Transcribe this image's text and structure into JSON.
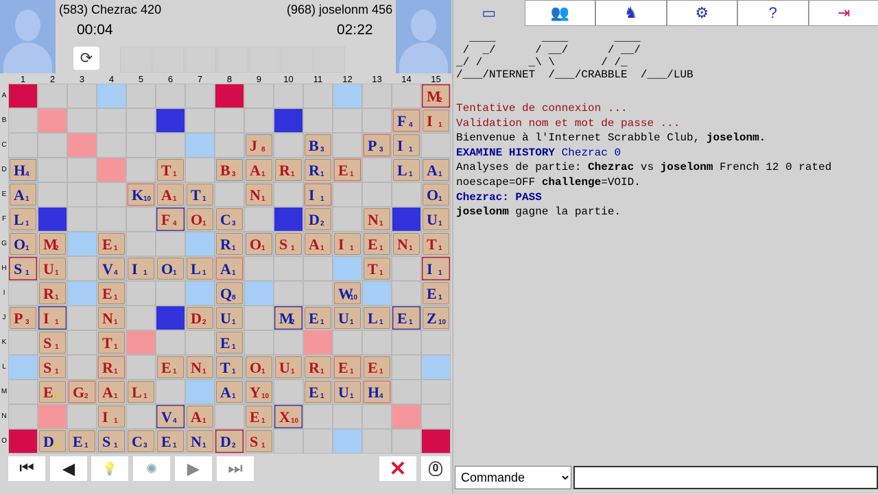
{
  "players": {
    "left": {
      "rating_name": "(583) Chezrac 420",
      "time": "00:04"
    },
    "right": {
      "rating_name": "(968) joselonm 456",
      "time": "02:22"
    }
  },
  "board": {
    "columns": [
      "1",
      "2",
      "3",
      "4",
      "5",
      "6",
      "7",
      "8",
      "9",
      "10",
      "11",
      "12",
      "13",
      "14",
      "15"
    ],
    "rows": [
      "A",
      "B",
      "C",
      "D",
      "E",
      "F",
      "G",
      "H",
      "I",
      "J",
      "K",
      "L",
      "M",
      "N",
      "O"
    ],
    "premium": [
      "T..d...T...d..T",
      ".D...t...t...D.",
      "..D...d.d...D..",
      "d..D...d...D..d",
      "....D.....D....",
      ".t...t...t...t.",
      "..d...d.d...d..",
      "T..d...D...d..T",
      "..d...d.d...d..",
      ".t...t...t...t.",
      "....D.....D....",
      "d..D...d...D..d",
      "..D...d.d...D..",
      ".D...t...t...D.",
      "T..d...T...d..T"
    ],
    "tiles": [
      {
        "r": 0,
        "c": 14,
        "l": "M",
        "p": "2",
        "col": "red"
      },
      {
        "r": 1,
        "c": 13,
        "l": "F",
        "p": "4",
        "col": "blue"
      },
      {
        "r": 1,
        "c": 14,
        "l": "I",
        "p": "1",
        "col": "red"
      },
      {
        "r": 2,
        "c": 8,
        "l": "J",
        "p": "8",
        "col": "red"
      },
      {
        "r": 2,
        "c": 10,
        "l": "B",
        "p": "3",
        "col": "blue"
      },
      {
        "r": 2,
        "c": 12,
        "l": "P",
        "p": "3",
        "col": "blue"
      },
      {
        "r": 2,
        "c": 13,
        "l": "I",
        "p": "1",
        "col": "blue"
      },
      {
        "r": 3,
        "c": 0,
        "l": "H",
        "p": "4",
        "col": "blue"
      },
      {
        "r": 3,
        "c": 5,
        "l": "T",
        "p": "1",
        "col": "red"
      },
      {
        "r": 3,
        "c": 7,
        "l": "B",
        "p": "3",
        "col": "red"
      },
      {
        "r": 3,
        "c": 8,
        "l": "A",
        "p": "1",
        "col": "red"
      },
      {
        "r": 3,
        "c": 9,
        "l": "R",
        "p": "1",
        "col": "red"
      },
      {
        "r": 3,
        "c": 10,
        "l": "R",
        "p": "1",
        "col": "blue"
      },
      {
        "r": 3,
        "c": 11,
        "l": "E",
        "p": "1",
        "col": "red"
      },
      {
        "r": 3,
        "c": 13,
        "l": "L",
        "p": "1",
        "col": "blue"
      },
      {
        "r": 3,
        "c": 14,
        "l": "A",
        "p": "1",
        "col": "blue"
      },
      {
        "r": 4,
        "c": 0,
        "l": "A",
        "p": "1",
        "col": "blue"
      },
      {
        "r": 4,
        "c": 4,
        "l": "K",
        "p": "10",
        "col": "blue"
      },
      {
        "r": 4,
        "c": 5,
        "l": "A",
        "p": "1",
        "col": "red"
      },
      {
        "r": 4,
        "c": 6,
        "l": "T",
        "p": "1",
        "col": "blue"
      },
      {
        "r": 4,
        "c": 8,
        "l": "N",
        "p": "1",
        "col": "red"
      },
      {
        "r": 4,
        "c": 10,
        "l": "I",
        "p": "1",
        "col": "blue"
      },
      {
        "r": 4,
        "c": 14,
        "l": "O",
        "p": "1",
        "col": "blue"
      },
      {
        "r": 5,
        "c": 0,
        "l": "L",
        "p": "1",
        "col": "blue"
      },
      {
        "r": 5,
        "c": 5,
        "l": "F",
        "p": "4",
        "col": "red"
      },
      {
        "r": 5,
        "c": 6,
        "l": "O",
        "p": "1",
        "col": "red"
      },
      {
        "r": 5,
        "c": 7,
        "l": "C",
        "p": "3",
        "col": "blue"
      },
      {
        "r": 5,
        "c": 10,
        "l": "D",
        "p": "2",
        "col": "blue"
      },
      {
        "r": 5,
        "c": 12,
        "l": "N",
        "p": "1",
        "col": "red"
      },
      {
        "r": 5,
        "c": 14,
        "l": "U",
        "p": "1",
        "col": "blue"
      },
      {
        "r": 6,
        "c": 0,
        "l": "O",
        "p": "1",
        "col": "blue"
      },
      {
        "r": 6,
        "c": 1,
        "l": "M",
        "p": "2",
        "col": "red"
      },
      {
        "r": 6,
        "c": 3,
        "l": "E",
        "p": "1",
        "col": "red"
      },
      {
        "r": 6,
        "c": 7,
        "l": "R",
        "p": "1",
        "col": "blue"
      },
      {
        "r": 6,
        "c": 8,
        "l": "O",
        "p": "1",
        "col": "red"
      },
      {
        "r": 6,
        "c": 9,
        "l": "S",
        "p": "1",
        "col": "red"
      },
      {
        "r": 6,
        "c": 10,
        "l": "A",
        "p": "1",
        "col": "red"
      },
      {
        "r": 6,
        "c": 11,
        "l": "I",
        "p": "1",
        "col": "red"
      },
      {
        "r": 6,
        "c": 12,
        "l": "E",
        "p": "1",
        "col": "red"
      },
      {
        "r": 6,
        "c": 13,
        "l": "N",
        "p": "1",
        "col": "red"
      },
      {
        "r": 6,
        "c": 14,
        "l": "T",
        "p": "1",
        "col": "red"
      },
      {
        "r": 7,
        "c": 0,
        "l": "S",
        "p": "1",
        "col": "blue"
      },
      {
        "r": 7,
        "c": 1,
        "l": "U",
        "p": "1",
        "col": "red"
      },
      {
        "r": 7,
        "c": 3,
        "l": "V",
        "p": "4",
        "col": "blue"
      },
      {
        "r": 7,
        "c": 4,
        "l": "I",
        "p": "1",
        "col": "blue"
      },
      {
        "r": 7,
        "c": 5,
        "l": "O",
        "p": "1",
        "col": "blue"
      },
      {
        "r": 7,
        "c": 6,
        "l": "L",
        "p": "1",
        "col": "blue"
      },
      {
        "r": 7,
        "c": 7,
        "l": "A",
        "p": "1",
        "col": "blue"
      },
      {
        "r": 7,
        "c": 12,
        "l": "T",
        "p": "1",
        "col": "red"
      },
      {
        "r": 7,
        "c": 14,
        "l": "I",
        "p": "1",
        "col": "blue"
      },
      {
        "r": 8,
        "c": 1,
        "l": "R",
        "p": "1",
        "col": "red"
      },
      {
        "r": 8,
        "c": 3,
        "l": "E",
        "p": "1",
        "col": "red"
      },
      {
        "r": 8,
        "c": 7,
        "l": "Q",
        "p": "8",
        "col": "blue"
      },
      {
        "r": 8,
        "c": 11,
        "l": "W",
        "p": "10",
        "col": "blue"
      },
      {
        "r": 8,
        "c": 14,
        "l": "E",
        "p": "1",
        "col": "blue"
      },
      {
        "r": 9,
        "c": 0,
        "l": "P",
        "p": "3",
        "col": "red"
      },
      {
        "r": 9,
        "c": 1,
        "l": "I",
        "p": "1",
        "col": "red"
      },
      {
        "r": 9,
        "c": 3,
        "l": "N",
        "p": "1",
        "col": "red"
      },
      {
        "r": 9,
        "c": 6,
        "l": "D",
        "p": "2",
        "col": "red"
      },
      {
        "r": 9,
        "c": 7,
        "l": "U",
        "p": "1",
        "col": "blue"
      },
      {
        "r": 9,
        "c": 9,
        "l": "M",
        "p": "2",
        "col": "blue"
      },
      {
        "r": 9,
        "c": 10,
        "l": "E",
        "p": "1",
        "col": "blue"
      },
      {
        "r": 9,
        "c": 11,
        "l": "U",
        "p": "1",
        "col": "blue"
      },
      {
        "r": 9,
        "c": 12,
        "l": "L",
        "p": "1",
        "col": "blue"
      },
      {
        "r": 9,
        "c": 13,
        "l": "E",
        "p": "1",
        "col": "blue"
      },
      {
        "r": 9,
        "c": 14,
        "l": "Z",
        "p": "10",
        "col": "blue"
      },
      {
        "r": 10,
        "c": 1,
        "l": "S",
        "p": "1",
        "col": "red"
      },
      {
        "r": 10,
        "c": 3,
        "l": "T",
        "p": "1",
        "col": "red"
      },
      {
        "r": 10,
        "c": 7,
        "l": "E",
        "p": "1",
        "col": "blue"
      },
      {
        "r": 11,
        "c": 1,
        "l": "S",
        "p": "1",
        "col": "red"
      },
      {
        "r": 11,
        "c": 3,
        "l": "R",
        "p": "1",
        "col": "red"
      },
      {
        "r": 11,
        "c": 5,
        "l": "E",
        "p": "1",
        "col": "red"
      },
      {
        "r": 11,
        "c": 6,
        "l": "N",
        "p": "1",
        "col": "red"
      },
      {
        "r": 11,
        "c": 7,
        "l": "T",
        "p": "1",
        "col": "blue"
      },
      {
        "r": 11,
        "c": 8,
        "l": "O",
        "p": "1",
        "col": "red"
      },
      {
        "r": 11,
        "c": 9,
        "l": "U",
        "p": "1",
        "col": "red"
      },
      {
        "r": 11,
        "c": 10,
        "l": "R",
        "p": "1",
        "col": "red"
      },
      {
        "r": 11,
        "c": 11,
        "l": "E",
        "p": "1",
        "col": "red"
      },
      {
        "r": 11,
        "c": 12,
        "l": "E",
        "p": "1",
        "col": "red"
      },
      {
        "r": 12,
        "c": 1,
        "l": "E",
        "p": "0",
        "col": "red",
        "blank": true
      },
      {
        "r": 12,
        "c": 2,
        "l": "G",
        "p": "2",
        "col": "red"
      },
      {
        "r": 12,
        "c": 3,
        "l": "A",
        "p": "1",
        "col": "red"
      },
      {
        "r": 12,
        "c": 4,
        "l": "L",
        "p": "1",
        "col": "red"
      },
      {
        "r": 12,
        "c": 7,
        "l": "A",
        "p": "1",
        "col": "blue"
      },
      {
        "r": 12,
        "c": 8,
        "l": "Y",
        "p": "10",
        "col": "red"
      },
      {
        "r": 12,
        "c": 10,
        "l": "E",
        "p": "1",
        "col": "blue"
      },
      {
        "r": 12,
        "c": 11,
        "l": "U",
        "p": "1",
        "col": "blue"
      },
      {
        "r": 12,
        "c": 12,
        "l": "H",
        "p": "4",
        "col": "blue"
      },
      {
        "r": 13,
        "c": 3,
        "l": "I",
        "p": "1",
        "col": "red"
      },
      {
        "r": 13,
        "c": 5,
        "l": "V",
        "p": "4",
        "col": "blue"
      },
      {
        "r": 13,
        "c": 6,
        "l": "A",
        "p": "1",
        "col": "red"
      },
      {
        "r": 13,
        "c": 8,
        "l": "E",
        "p": "1",
        "col": "red"
      },
      {
        "r": 13,
        "c": 9,
        "l": "X",
        "p": "10",
        "col": "red"
      },
      {
        "r": 14,
        "c": 1,
        "l": "D",
        "p": "0",
        "col": "blue",
        "blank": true
      },
      {
        "r": 14,
        "c": 2,
        "l": "E",
        "p": "1",
        "col": "blue"
      },
      {
        "r": 14,
        "c": 3,
        "l": "S",
        "p": "1",
        "col": "blue"
      },
      {
        "r": 14,
        "c": 4,
        "l": "C",
        "p": "3",
        "col": "blue"
      },
      {
        "r": 14,
        "c": 5,
        "l": "E",
        "p": "1",
        "col": "blue"
      },
      {
        "r": 14,
        "c": 6,
        "l": "N",
        "p": "1",
        "col": "blue"
      },
      {
        "r": 14,
        "c": 7,
        "l": "D",
        "p": "2",
        "col": "blue"
      },
      {
        "r": 14,
        "c": 8,
        "l": "S",
        "p": "1",
        "col": "red"
      }
    ]
  },
  "controls": {
    "first": "⏮",
    "prev": "◀",
    "hint": "💡",
    "spinner": "✺",
    "next": "▶",
    "last": "⏭",
    "close": "✕",
    "bag_count": "0"
  },
  "toolbar_icons": [
    "window-icon",
    "users-icon",
    "player-at-table-icon",
    "gear-icon",
    "help-icon",
    "exit-icon"
  ],
  "ascii_logo": "  ____       ____       ____\n /  _/      / __/      / __/\n_/ /       _\\ \\       / /_\n/___/NTERNET  /___/CRABBLE  /___/LUB",
  "log": {
    "l1": "Tentative de connexion ...",
    "l2": "Validation nom et mot de passe ...",
    "l3a": "Bienvenue à l'Internet Scrabble Club, ",
    "l3b": "joselonm.",
    "l4a": "EXAMINE HISTORY",
    "l4b": " Chezrac 0",
    "l5a": "Analyses de partie: ",
    "l5b": "Chezrac",
    "l5c": " vs ",
    "l5d": "joselonm",
    "l5e": " French 12 0 rated",
    "l6a": "noescape=OFF ",
    "l6b": "challenge",
    "l6c": "=VOID.",
    "l7": "Chezrac: PASS",
    "l8a": "joselonm",
    "l8b": " gagne la partie."
  },
  "command": {
    "selected": "Commande",
    "input_value": ""
  }
}
